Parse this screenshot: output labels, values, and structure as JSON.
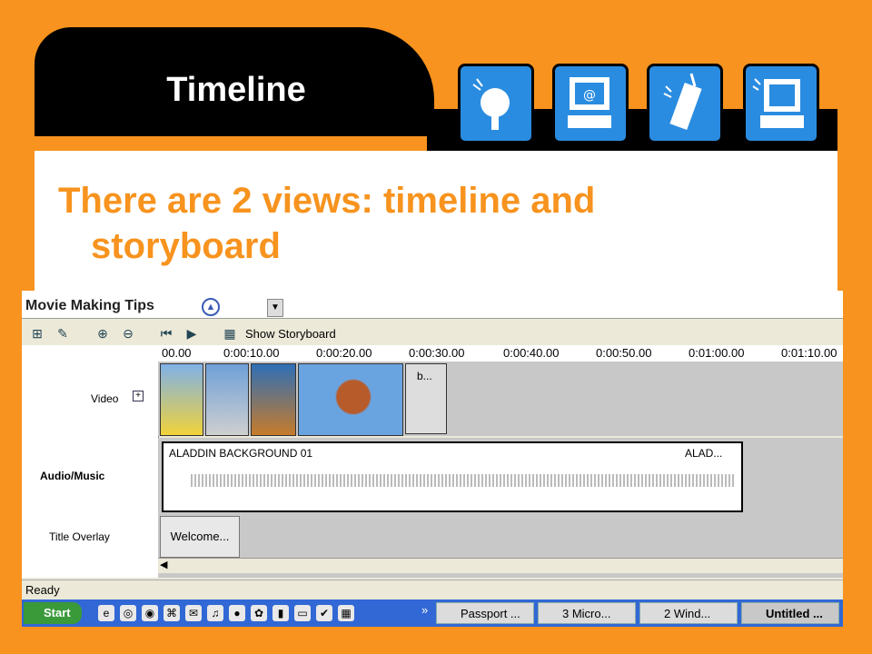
{
  "slide": {
    "title": "Timeline",
    "headline_line1": "There are 2 views:  timeline and",
    "headline_line2": "storyboard",
    "icons": [
      "satellite-dish-icon",
      "computer-email-icon",
      "cell-phone-icon",
      "computer-terminal-icon"
    ]
  },
  "app": {
    "panel_title": "Movie Making Tips",
    "toolbar_show_storyboard": "Show Storyboard",
    "track_labels": {
      "video": "Video",
      "audio": "Audio/Music",
      "overlay": "Title Overlay"
    },
    "ruler_ticks": [
      "00.00",
      "0:00:10.00",
      "0:00:20.00",
      "0:00:30.00",
      "0:00:40.00",
      "0:00:50.00",
      "0:01:00.00",
      "0:01:10.00"
    ],
    "video_clip_last_label": "b...",
    "audio_clip_title": "ALADDIN BACKGROUND 01",
    "audio_clip_end": "ALAD...",
    "overlay_clip": "Welcome...",
    "status": "Ready"
  },
  "taskbar": {
    "start": "Start",
    "chevron": "»",
    "buttons": [
      "Passport ...",
      "3 Micro...",
      "2 Wind...",
      "Untitled ..."
    ]
  },
  "colors": {
    "slide_bg": "#f7931e",
    "accent_text": "#f7931e",
    "icon_blue": "#2a8ce0",
    "taskbar": "#3168d5"
  }
}
